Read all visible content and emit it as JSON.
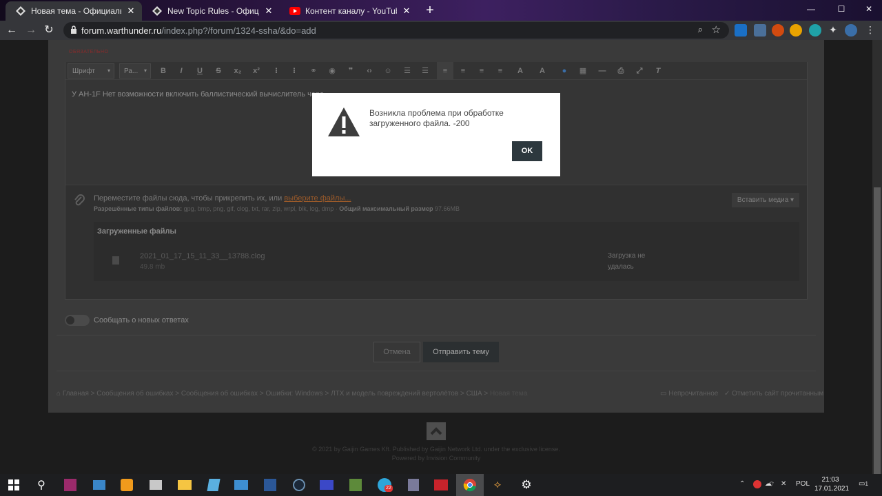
{
  "browser": {
    "tabs": [
      {
        "title": "Новая тема - Официальный фо",
        "icon": "warthunder-favicon",
        "active": true
      },
      {
        "title": "New Topic Rules - Официальный",
        "icon": "warthunder-favicon",
        "active": false
      },
      {
        "title": "Контент каналу - YouTube Studio",
        "icon": "youtube-favicon",
        "active": false
      }
    ],
    "new_tab": "+",
    "window": {
      "minimize": "—",
      "maximize": "☐",
      "close": "✕"
    },
    "url_host": "forum.warthunder.ru",
    "url_path": "/index.php?/forum/1324-ssha/&do=add"
  },
  "editor": {
    "required_label": "ОБЯЗАТЕЛЬНО",
    "font_select": "Шрифт",
    "size_select": "Ра...",
    "body_text": "У АН-1F Нет возможности включить баллистический вычислитель чере"
  },
  "attachments": {
    "drop_text": "Переместите файлы сюда, чтобы прикрепить их, или",
    "choose_link": "выберите файлы...",
    "allowed_label": "Разрешённые типы файлов:",
    "allowed_types": "gpg, bmp, png, gif, clog, txt, rar, zip, wrpl, blk, log, dmp",
    "max_label": "Общий максимальный размер",
    "max_size": "97.66MB",
    "embed_button": "Вставить медиа",
    "uploaded_title": "Загруженные файлы",
    "files": [
      {
        "name": "2021_01_17_15_11_33__13788.clog",
        "size": "49.8 mb",
        "status_line1": "Загрузка не",
        "status_line2": "удалась"
      }
    ]
  },
  "notify_label": "Сообщать о новых ответах",
  "actions": {
    "cancel": "Отмена",
    "submit": "Отправить тему"
  },
  "breadcrumb": {
    "items": [
      "Главная",
      "Сообщения об ошибках",
      "Сообщения об ошибках",
      "Ошибки: Windows",
      "ЛТХ и модель повреждений вертолётов",
      "США",
      "Новая тема"
    ],
    "separator": ">",
    "unread": "Непрочитанное",
    "mark_read": "Отметить сайт прочитанным"
  },
  "footer": {
    "copyright": "© 2021 by Gaijin Games Kft. Published by Gaijin Network Ltd. under the exclusive license.",
    "powered": "Powered by Invision Community"
  },
  "modal": {
    "message_line1": "Возникла проблема при обработке",
    "message_line2": "загруженного файла. -200",
    "ok": "OK"
  },
  "taskbar": {
    "language": "POL",
    "time": "21:03",
    "date": "17.01.2021",
    "telegram_badge": "22",
    "notification_badge": "1"
  },
  "colors": {
    "accent": "#2d383e",
    "link": "#9a5a2a",
    "warning_icon": "#3d3d3d"
  }
}
